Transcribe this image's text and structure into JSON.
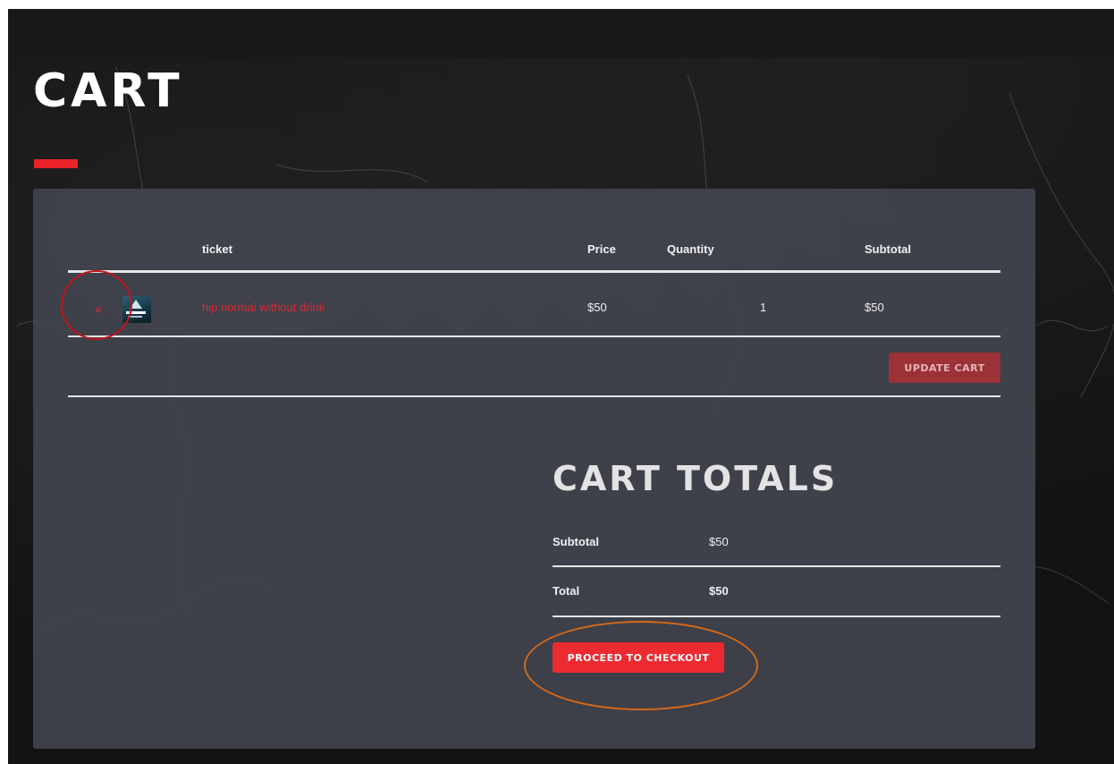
{
  "page": {
    "title": "CART"
  },
  "cart_table": {
    "headers": {
      "product": "ticket",
      "price": "Price",
      "quantity": "Quantity",
      "subtotal": "Subtotal"
    },
    "rows": [
      {
        "remove_symbol": "×",
        "thumbnail_icon": "ticket-thumbnail-icon",
        "product_name": "hip normal without drink",
        "price": "$50",
        "quantity": "1",
        "subtotal": "$50"
      }
    ],
    "update_label": "UPDATE CART"
  },
  "totals": {
    "title": "CART TOTALS",
    "subtotal_label": "Subtotal",
    "subtotal_value": "$50",
    "total_label": "Total",
    "total_value": "$50",
    "checkout_label": "PROCEED TO CHECKOUT"
  },
  "colors": {
    "accent": "#e8242a",
    "panel": "#424550",
    "background": "#131313",
    "link": "#d82a33",
    "annotation_remove": "#c0141b",
    "annotation_checkout": "#d36a16"
  }
}
